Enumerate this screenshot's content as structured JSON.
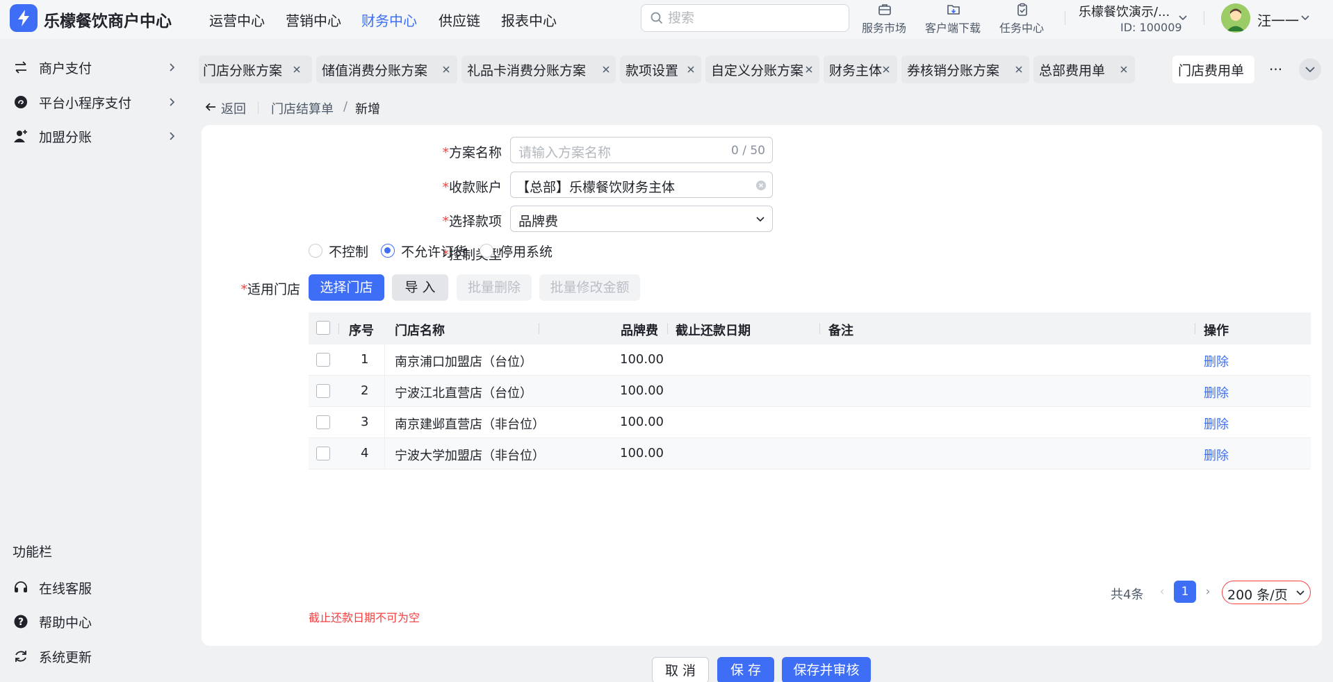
{
  "brand": {
    "title": "乐檬餐饮商户中心"
  },
  "nav": {
    "items": [
      {
        "label": "运营中心"
      },
      {
        "label": "营销中心"
      },
      {
        "label": "财务中心",
        "active": true
      },
      {
        "label": "供应链"
      },
      {
        "label": "报表中心"
      }
    ]
  },
  "search": {
    "placeholder": "搜索"
  },
  "tools": {
    "market": "服务市场",
    "download": "客户端下载",
    "tasks": "任务中心"
  },
  "org": {
    "name": "乐檬餐饮演示/...",
    "id": "ID: 100009"
  },
  "user": {
    "name": "汪一一"
  },
  "sidebar": {
    "items": [
      {
        "label": "商户支付",
        "icon": "exchange-icon"
      },
      {
        "label": "平台小程序支付",
        "icon": "mini-program-icon"
      },
      {
        "label": "加盟分账",
        "icon": "user-add-icon"
      }
    ],
    "section_title": "功能栏",
    "tools": [
      {
        "label": "在线客服",
        "icon": "headset-icon"
      },
      {
        "label": "帮助中心",
        "icon": "help-icon"
      },
      {
        "label": "系统更新",
        "icon": "refresh-icon"
      }
    ]
  },
  "tabs": [
    {
      "label": "门店分账方案"
    },
    {
      "label": "储值消费分账方案"
    },
    {
      "label": "礼品卡消费分账方案"
    },
    {
      "label": "款项设置"
    },
    {
      "label": "自定义分账方案"
    },
    {
      "label": "财务主体"
    },
    {
      "label": "券核销分账方案"
    },
    {
      "label": "总部费用单"
    },
    {
      "label": "门店费用单",
      "active": true
    }
  ],
  "tabs_more": "···",
  "breadcrumb": {
    "back": "返回",
    "parent": "门店结算单",
    "sep": "/",
    "current": "新增"
  },
  "form": {
    "required_mark": "*",
    "plan_name": {
      "label": "方案名称",
      "placeholder": "请输入方案名称",
      "counter": "0 / 50"
    },
    "account": {
      "label": "收款账户",
      "value": "【总部】乐檬餐饮财务主体"
    },
    "item": {
      "label": "选择款项",
      "value": "品牌费"
    },
    "control": {
      "label": "控制类型",
      "options": [
        {
          "label": "不控制",
          "checked": false
        },
        {
          "label": "不允许订货",
          "checked": true
        },
        {
          "label": "停用系统",
          "checked": false
        }
      ]
    },
    "stores": {
      "label": "适用门店"
    }
  },
  "actions": {
    "select": "选择门店",
    "import": "导 入",
    "batch_delete": "批量删除",
    "batch_edit": "批量修改金额"
  },
  "table": {
    "headers": {
      "index": "序号",
      "name": "门店名称",
      "fee": "品牌费",
      "due": "截止还款日期",
      "note": "备注",
      "op": "操作"
    },
    "rows": [
      {
        "index": "1",
        "name": "南京浦口加盟店（台位）",
        "fee": "100.00",
        "due": "",
        "note": "",
        "op": "删除"
      },
      {
        "index": "2",
        "name": "宁波江北直营店（台位）",
        "fee": "100.00",
        "due": "",
        "note": "",
        "op": "删除"
      },
      {
        "index": "3",
        "name": "南京建邺直营店（非台位）",
        "fee": "100.00",
        "due": "",
        "note": "",
        "op": "删除"
      },
      {
        "index": "4",
        "name": "宁波大学加盟店（非台位）",
        "fee": "100.00",
        "due": "",
        "note": "",
        "op": "删除"
      }
    ]
  },
  "pagination": {
    "total": "共4条",
    "prev": "‹",
    "page": "1",
    "next": "›",
    "size": "200 条/页"
  },
  "error": "截止还款日期不可为空",
  "footer": {
    "cancel": "取 消",
    "save": "保 存",
    "save_audit": "保存并审核"
  },
  "colors": {
    "primary": "#3d6ef5",
    "danger": "#f53f3f"
  }
}
